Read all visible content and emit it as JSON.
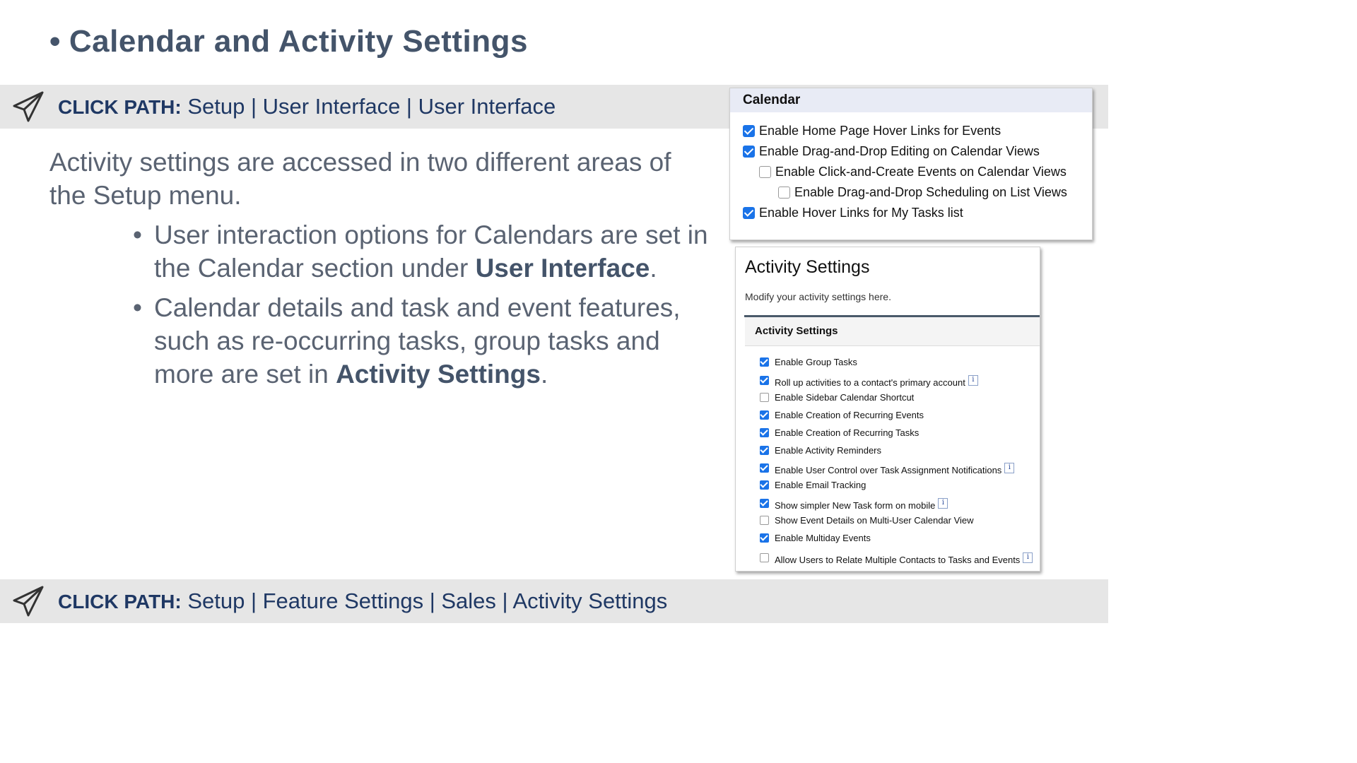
{
  "title": {
    "bullet": "•",
    "text": "Calendar and Activity Settings"
  },
  "click_path_top": {
    "label": "CLICK PATH:",
    "path": " Setup | User Interface | User Interface"
  },
  "intro": "Activity settings are accessed in two different areas of the Setup menu.",
  "bullets": [
    {
      "before": "User interaction options for Calendars are set in the Calendar section under ",
      "bold": "User Interface",
      "after": "."
    },
    {
      "before": "Calendar details and task and event features, such as re-occurring tasks, group tasks and more are set in ",
      "bold": "Activity Settings",
      "after": "."
    }
  ],
  "calendar_panel": {
    "header": "Calendar",
    "items": [
      {
        "label": "Enable Home Page Hover Links for Events",
        "checked": true
      },
      {
        "label": "Enable Drag-and-Drop Editing on Calendar Views",
        "checked": true
      },
      {
        "label": "Enable Click-and-Create Events on Calendar Views",
        "checked": false
      },
      {
        "label": "Enable Drag-and-Drop Scheduling on List Views",
        "checked": false
      },
      {
        "label": "Enable Hover Links for My Tasks list",
        "checked": true
      }
    ]
  },
  "activity_panel": {
    "title": "Activity Settings",
    "subtitle": "Modify your activity settings here.",
    "section_header": "Activity Settings",
    "items": [
      {
        "label": "Enable Group Tasks",
        "checked": true,
        "info": false
      },
      {
        "label": "Roll up activities to a contact's primary account",
        "checked": true,
        "info": true
      },
      {
        "label": "Enable Sidebar Calendar Shortcut",
        "checked": false,
        "info": false
      },
      {
        "label": "Enable Creation of Recurring Events",
        "checked": true,
        "info": false
      },
      {
        "label": "Enable Creation of Recurring Tasks",
        "checked": true,
        "info": false
      },
      {
        "label": "Enable Activity Reminders",
        "checked": true,
        "info": false
      },
      {
        "label": "Enable User Control over Task Assignment Notifications",
        "checked": true,
        "info": true
      },
      {
        "label": "Enable Email Tracking",
        "checked": true,
        "info": false
      },
      {
        "label": "Show simpler New Task form on mobile",
        "checked": true,
        "info": true
      },
      {
        "label": "Show Event Details on Multi-User Calendar View",
        "checked": false,
        "info": false
      },
      {
        "label": "Enable Multiday Events",
        "checked": true,
        "info": false
      },
      {
        "label": "Allow Users to Relate Multiple Contacts to Tasks and Events",
        "checked": false,
        "info": true
      }
    ],
    "info_glyph": "i"
  },
  "click_path_bottom": {
    "label": "CLICK PATH:",
    "path": " Setup | Feature Settings | Sales | Activity Settings"
  },
  "colors": {
    "title": "#44546a",
    "band": "#e6e6e6",
    "path": "#1f3864",
    "checkbox": "#1a73e8"
  }
}
